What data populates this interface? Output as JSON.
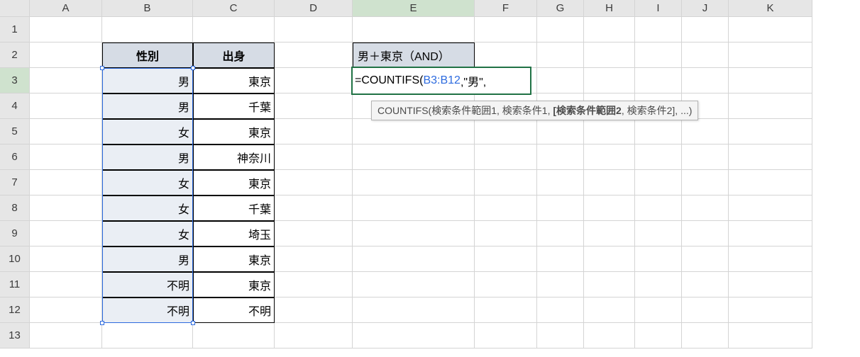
{
  "columns": [
    "A",
    "B",
    "C",
    "D",
    "E",
    "F",
    "G",
    "H",
    "I",
    "J",
    "K"
  ],
  "rows": [
    "1",
    "2",
    "3",
    "4",
    "5",
    "6",
    "7",
    "8",
    "9",
    "10",
    "11",
    "12",
    "13"
  ],
  "table": {
    "headers": {
      "b": "性別",
      "c": "出身"
    },
    "rows": [
      {
        "b": "男",
        "c": "東京"
      },
      {
        "b": "男",
        "c": "千葉"
      },
      {
        "b": "女",
        "c": "東京"
      },
      {
        "b": "男",
        "c": "神奈川"
      },
      {
        "b": "女",
        "c": "東京"
      },
      {
        "b": "女",
        "c": "千葉"
      },
      {
        "b": "女",
        "c": "埼玉"
      },
      {
        "b": "男",
        "c": "東京"
      },
      {
        "b": "不明",
        "c": "東京"
      },
      {
        "b": "不明",
        "c": "不明"
      }
    ]
  },
  "e2": "男＋東京（AND）",
  "formula": {
    "prefix": "=COUNTIFS(",
    "ref": "B3:B12",
    "suffix": ",\"男\","
  },
  "tooltip": {
    "fn": "COUNTIFS(",
    "p1": "検索条件範囲1",
    "p2": "検索条件1",
    "p3_bold": "[検索条件範囲2",
    "p4": "検索条件2]",
    "tail": "...)"
  },
  "active_col": "E",
  "active_row": "3",
  "chart_data": {
    "type": "table",
    "title": "",
    "columns": [
      "性別",
      "出身"
    ],
    "rows": [
      [
        "男",
        "東京"
      ],
      [
        "男",
        "千葉"
      ],
      [
        "女",
        "東京"
      ],
      [
        "男",
        "神奈川"
      ],
      [
        "女",
        "東京"
      ],
      [
        "女",
        "千葉"
      ],
      [
        "女",
        "埼玉"
      ],
      [
        "男",
        "東京"
      ],
      [
        "不明",
        "東京"
      ],
      [
        "不明",
        "不明"
      ]
    ]
  }
}
